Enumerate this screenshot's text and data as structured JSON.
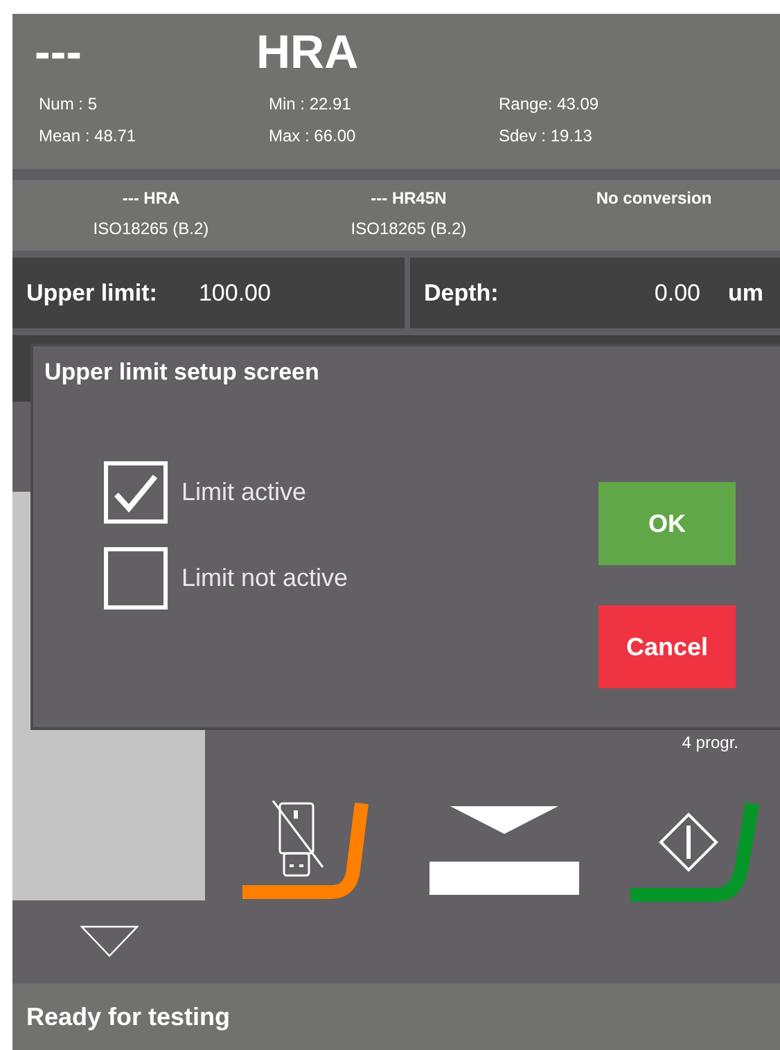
{
  "header": {
    "value": "---",
    "scale": "HRA",
    "stats": [
      "Num : 5",
      "Min : 22.91",
      "Range: 43.09",
      "Mean : 48.71",
      "Max : 66.00",
      "Sdev : 19.13"
    ]
  },
  "conversions": [
    {
      "scale": "--- HRA",
      "standard": "ISO18265 (B.2)"
    },
    {
      "scale": "--- HR45N",
      "standard": "ISO18265 (B.2)"
    },
    {
      "scale": "No conversion"
    }
  ],
  "fields": [
    {
      "label": "Upper limit:",
      "value": "100.00"
    },
    {
      "label": "Depth:",
      "value": "0.00",
      "unit": "um"
    }
  ],
  "dialog": {
    "title": "Upper limit setup screen",
    "options": [
      {
        "label": "Limit active",
        "checked": true
      },
      {
        "label": "Limit not active",
        "checked": false
      }
    ],
    "buttons": [
      {
        "label": "OK",
        "kind": "confirm"
      },
      {
        "label": "Cancel",
        "kind": "cancel"
      }
    ]
  },
  "program_count": "4 progr.",
  "status_bar": "Ready for testing"
}
